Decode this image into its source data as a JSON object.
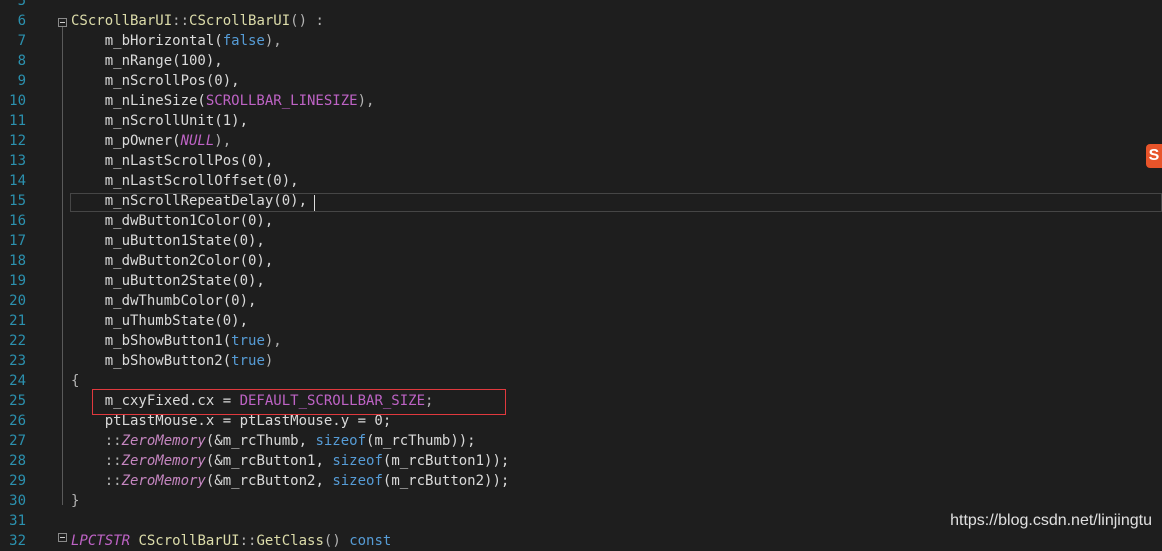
{
  "lines": [
    {
      "num": "5",
      "segments": []
    },
    {
      "num": "6",
      "segments": [
        {
          "t": "CScrollBarUI",
          "c": "yellow"
        },
        {
          "t": "::",
          "c": "punct"
        },
        {
          "t": "CScrollBarUI",
          "c": "yellow"
        },
        {
          "t": "() :",
          "c": "punct"
        }
      ]
    },
    {
      "num": "7",
      "segments": [
        {
          "t": "    m_bHorizontal(",
          "c": "member"
        },
        {
          "t": "false",
          "c": "blue"
        },
        {
          "t": "),",
          "c": "punct"
        }
      ]
    },
    {
      "num": "8",
      "segments": [
        {
          "t": "    m_nRange(100),",
          "c": "member"
        }
      ]
    },
    {
      "num": "9",
      "segments": [
        {
          "t": "    m_nScrollPos(0),",
          "c": "member"
        }
      ]
    },
    {
      "num": "10",
      "segments": [
        {
          "t": "    m_nLineSize(",
          "c": "member"
        },
        {
          "t": "SCROLLBAR_LINESIZE",
          "c": "macro"
        },
        {
          "t": "),",
          "c": "punct"
        }
      ]
    },
    {
      "num": "11",
      "segments": [
        {
          "t": "    m_nScrollUnit(1),",
          "c": "member"
        }
      ]
    },
    {
      "num": "12",
      "segments": [
        {
          "t": "    m_pOwner(",
          "c": "member"
        },
        {
          "t": "NULL",
          "c": "italic-macro"
        },
        {
          "t": "),",
          "c": "punct"
        }
      ]
    },
    {
      "num": "13",
      "segments": [
        {
          "t": "    m_nLastScrollPos(0),",
          "c": "member"
        }
      ]
    },
    {
      "num": "14",
      "segments": [
        {
          "t": "    m_nLastScrollOffset(0),",
          "c": "member"
        }
      ]
    },
    {
      "num": "15",
      "segments": [
        {
          "t": "    m_nScrollRepeatDelay(0),",
          "c": "member"
        }
      ]
    },
    {
      "num": "16",
      "segments": [
        {
          "t": "    m_dwButton1Color(0),",
          "c": "member"
        }
      ]
    },
    {
      "num": "17",
      "segments": [
        {
          "t": "    m_uButton1State(0),",
          "c": "member"
        }
      ]
    },
    {
      "num": "18",
      "segments": [
        {
          "t": "    m_dwButton2Color(0),",
          "c": "member"
        }
      ]
    },
    {
      "num": "19",
      "segments": [
        {
          "t": "    m_uButton2State(0),",
          "c": "member"
        }
      ]
    },
    {
      "num": "20",
      "segments": [
        {
          "t": "    m_dwThumbColor(0),",
          "c": "member"
        }
      ]
    },
    {
      "num": "21",
      "segments": [
        {
          "t": "    m_uThumbState(0),",
          "c": "member"
        }
      ]
    },
    {
      "num": "22",
      "segments": [
        {
          "t": "    m_bShowButton1(",
          "c": "member"
        },
        {
          "t": "true",
          "c": "blue"
        },
        {
          "t": "),",
          "c": "punct"
        }
      ]
    },
    {
      "num": "23",
      "segments": [
        {
          "t": "    m_bShowButton2(",
          "c": "member"
        },
        {
          "t": "true",
          "c": "blue"
        },
        {
          "t": ")",
          "c": "punct"
        }
      ]
    },
    {
      "num": "24",
      "segments": [
        {
          "t": "{",
          "c": "punct"
        }
      ]
    },
    {
      "num": "25",
      "segments": [
        {
          "t": "    m_cxyFixed.cx = ",
          "c": "member"
        },
        {
          "t": "DEFAULT_SCROLLBAR_SIZE",
          "c": "macro"
        },
        {
          "t": ";",
          "c": "punct"
        }
      ]
    },
    {
      "num": "26",
      "segments": [
        {
          "t": "    ptLastMouse.x = ptLastMouse.y = 0;",
          "c": "member"
        }
      ]
    },
    {
      "num": "27",
      "segments": [
        {
          "t": "    ::",
          "c": "punct"
        },
        {
          "t": "ZeroMemory",
          "c": "func-italic"
        },
        {
          "t": "(&m_rcThumb, ",
          "c": "member"
        },
        {
          "t": "sizeof",
          "c": "blue"
        },
        {
          "t": "(m_rcThumb));",
          "c": "member"
        }
      ]
    },
    {
      "num": "28",
      "segments": [
        {
          "t": "    ::",
          "c": "punct"
        },
        {
          "t": "ZeroMemory",
          "c": "func-italic"
        },
        {
          "t": "(&m_rcButton1, ",
          "c": "member"
        },
        {
          "t": "sizeof",
          "c": "blue"
        },
        {
          "t": "(m_rcButton1));",
          "c": "member"
        }
      ]
    },
    {
      "num": "29",
      "segments": [
        {
          "t": "    ::",
          "c": "punct"
        },
        {
          "t": "ZeroMemory",
          "c": "func-italic"
        },
        {
          "t": "(&m_rcButton2, ",
          "c": "member"
        },
        {
          "t": "sizeof",
          "c": "blue"
        },
        {
          "t": "(m_rcButton2));",
          "c": "member"
        }
      ]
    },
    {
      "num": "30",
      "segments": [
        {
          "t": "}",
          "c": "punct"
        }
      ]
    },
    {
      "num": "31",
      "segments": []
    },
    {
      "num": "32",
      "segments": [
        {
          "t": "LPCTSTR ",
          "c": "italic-macro"
        },
        {
          "t": "CScrollBarUI",
          "c": "yellow"
        },
        {
          "t": "::",
          "c": "punct"
        },
        {
          "t": "GetClass",
          "c": "yellow"
        },
        {
          "t": "() ",
          "c": "punct"
        },
        {
          "t": "const",
          "c": "blue"
        }
      ]
    }
  ],
  "watermark": "https://blog.csdn.net/linjingtu",
  "ime_logo_letter": "S",
  "colors": {
    "background": "#1e1e1e",
    "line_number": "#2b91af",
    "keyword": "#569cd6",
    "macro": "#be63c5",
    "function": "#dcdcaa",
    "highlight": "#e0393e"
  }
}
